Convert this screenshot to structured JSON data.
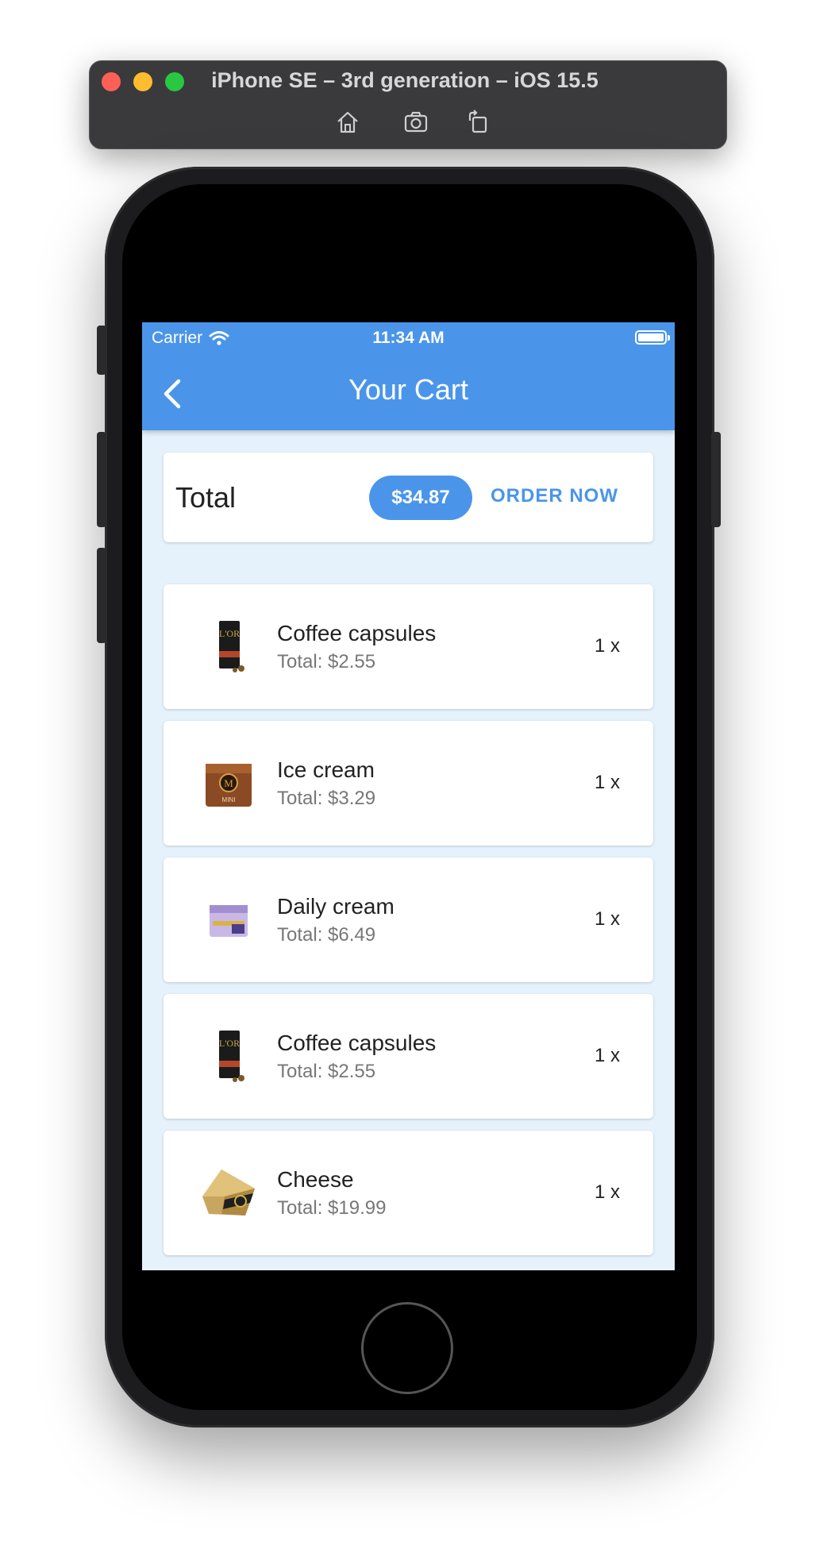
{
  "simulator": {
    "title": "iPhone SE – 3rd generation – iOS 15.5",
    "tools": [
      "home-icon",
      "screenshot-icon",
      "rotate-icon"
    ]
  },
  "status_bar": {
    "carrier": "Carrier",
    "time": "11:34 AM"
  },
  "appbar": {
    "title": "Your Cart",
    "color": "#4a95ea"
  },
  "summary": {
    "label": "Total",
    "amount": "$34.87",
    "order_label": "ORDER NOW"
  },
  "items": [
    {
      "name": "Coffee capsules",
      "total": "Total: $2.55",
      "qty": "1 x",
      "icon": "coffee-capsules-box"
    },
    {
      "name": "Ice cream",
      "total": "Total: $3.29",
      "qty": "1 x",
      "icon": "ice-cream-box"
    },
    {
      "name": "Daily cream",
      "total": "Total: $6.49",
      "qty": "1 x",
      "icon": "cream-jar"
    },
    {
      "name": "Coffee capsules",
      "total": "Total: $2.55",
      "qty": "1 x",
      "icon": "coffee-capsules-box"
    },
    {
      "name": "Cheese",
      "total": "Total: $19.99",
      "qty": "1 x",
      "icon": "cheese-wedge"
    }
  ]
}
